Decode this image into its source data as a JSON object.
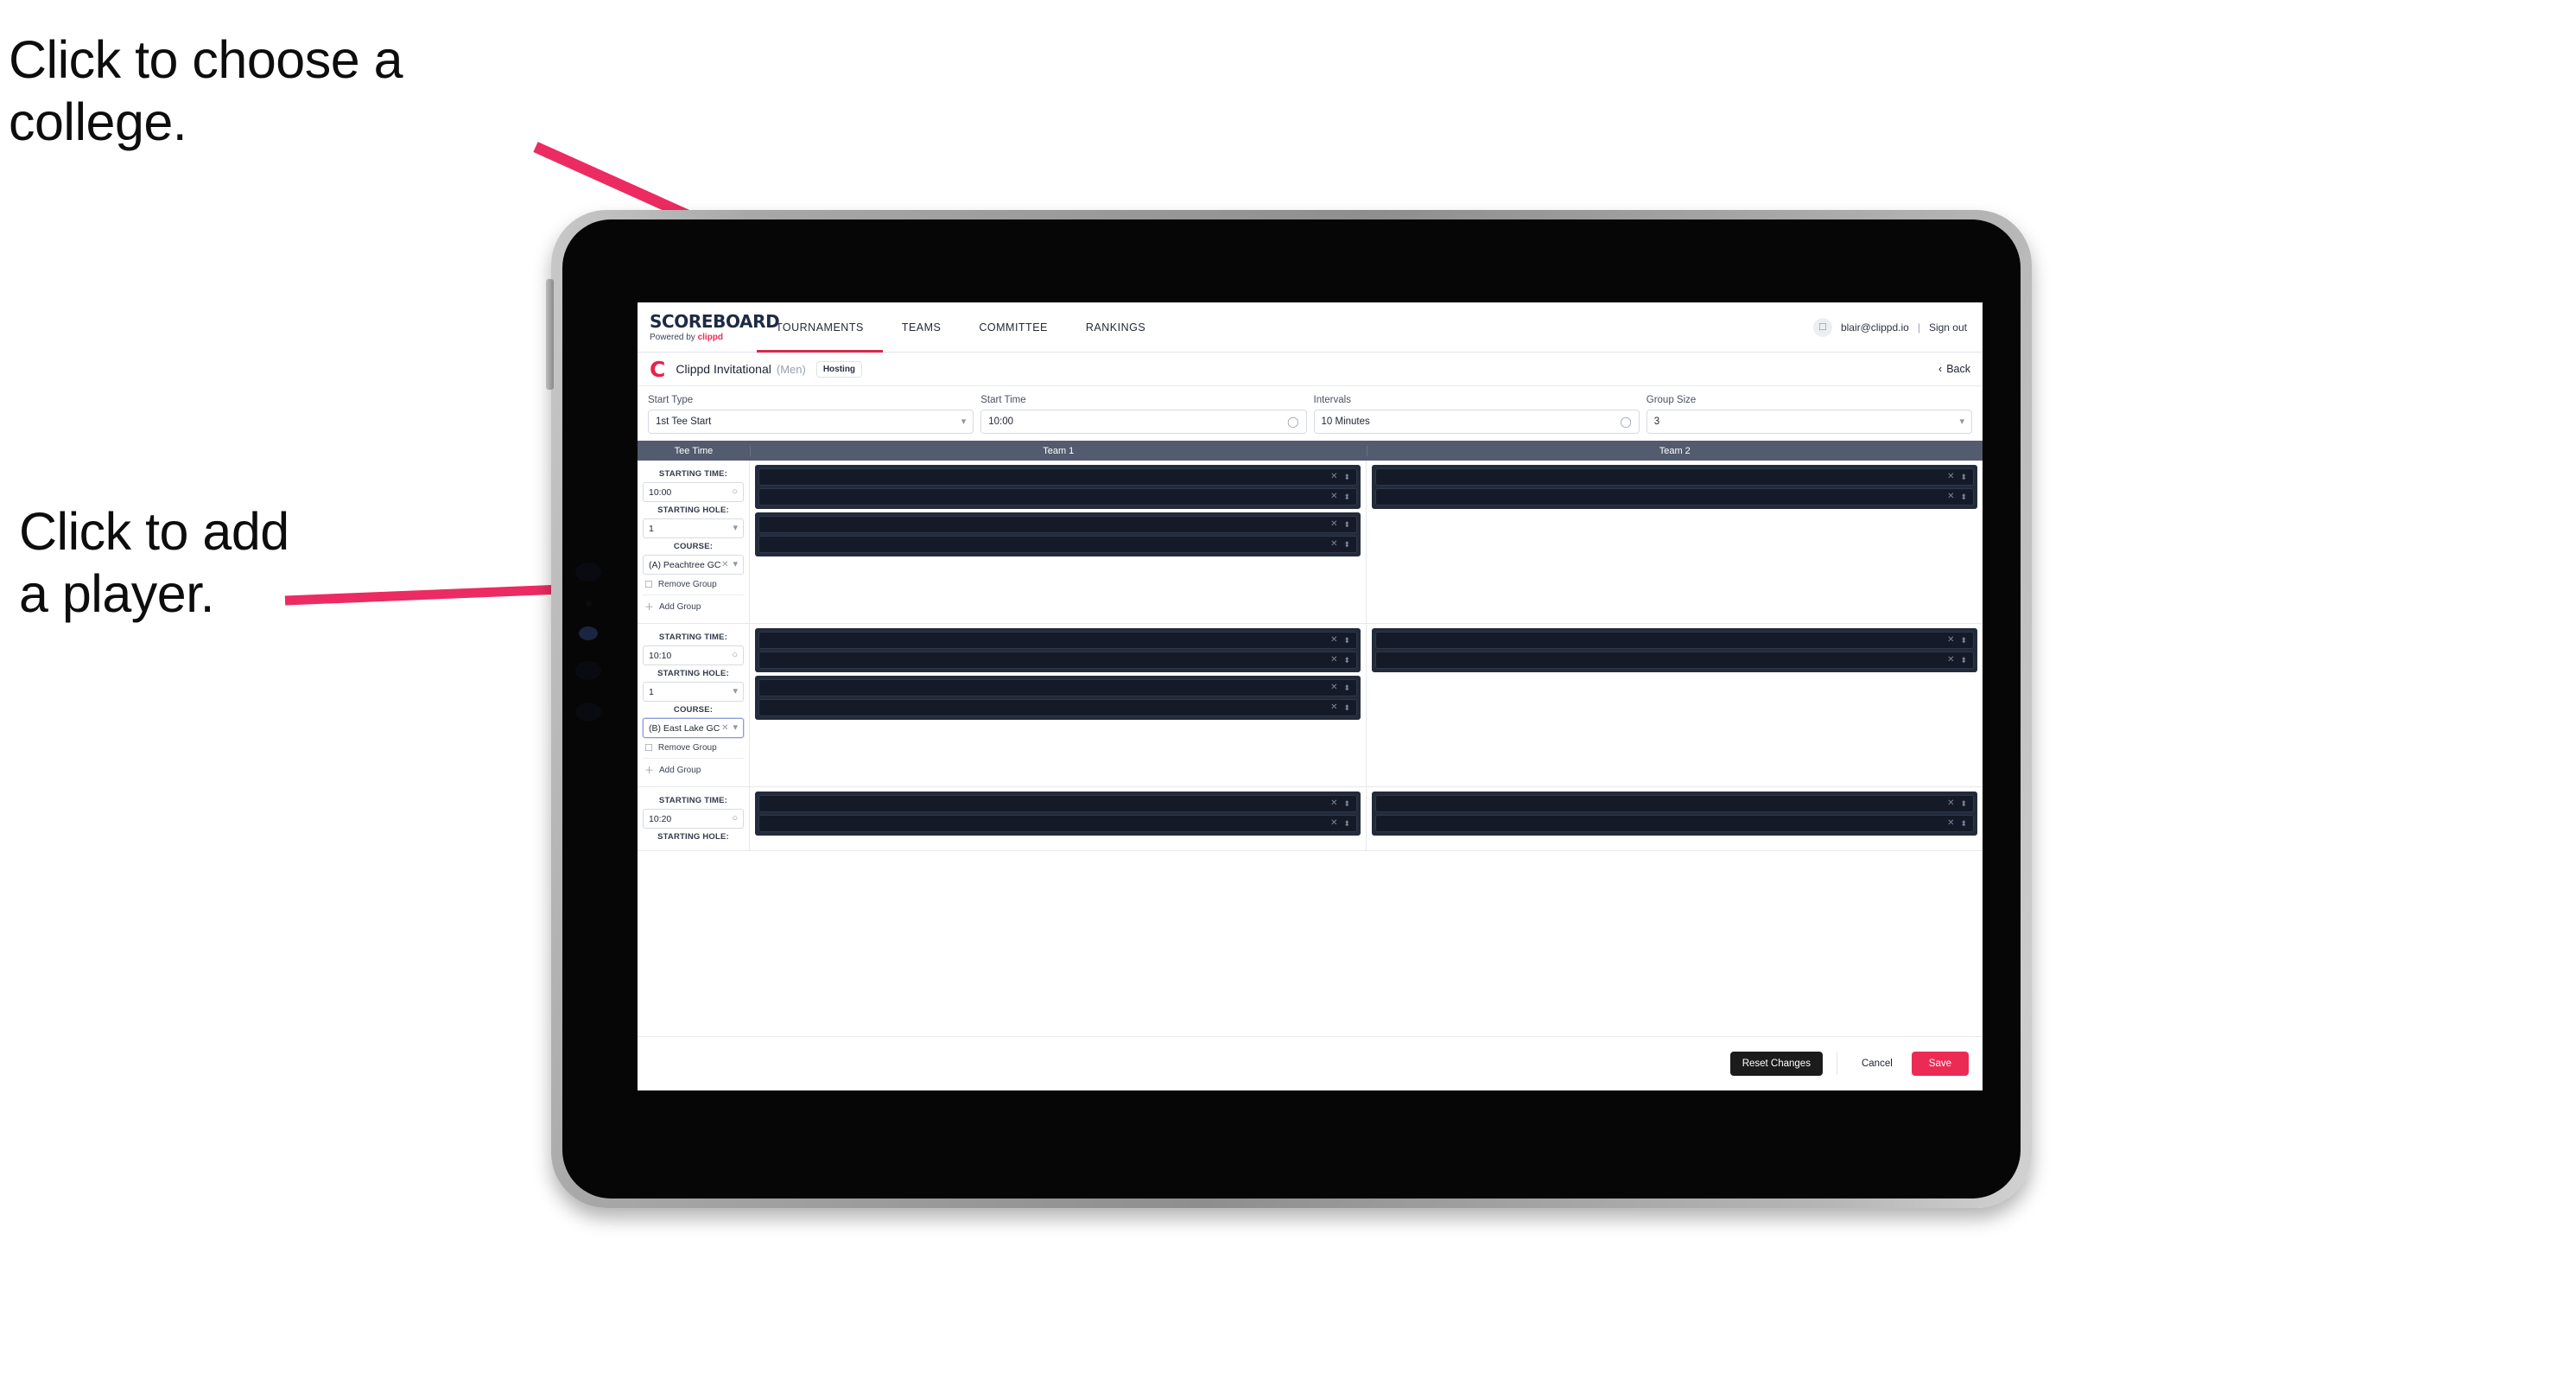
{
  "annotations": [
    {
      "id": "choose-college",
      "text": "Click to choose a\ncollege."
    },
    {
      "id": "add-player",
      "text": "Click to add\na player."
    }
  ],
  "app": {
    "nav": {
      "brand_title": "SCOREBOARD",
      "brand_sub_prefix": "Powered by ",
      "brand_sub_name": "clippd",
      "items": [
        {
          "label": "TOURNAMENTS",
          "active": true
        },
        {
          "label": "TEAMS",
          "active": false
        },
        {
          "label": "COMMITTEE",
          "active": false
        },
        {
          "label": "RANKINGS",
          "active": false
        }
      ],
      "avatar_icon": "user-icon",
      "user_email": "blair@clippd.io",
      "separator": "|",
      "sign_out": "Sign out"
    },
    "tournament_bar": {
      "logo_letter": "C",
      "name": "Clippd Invitational",
      "gender": "(Men)",
      "badge": "Hosting",
      "back_label": "Back",
      "back_icon": "chevron-left-icon"
    },
    "form": {
      "fields": [
        {
          "label": "Start Type",
          "value": "1st Tee Start",
          "icon": "stepper-icon"
        },
        {
          "label": "Start Time",
          "value": "10:00",
          "icon": "clock-icon"
        },
        {
          "label": "Intervals",
          "value": "10 Minutes",
          "icon": "clock-icon"
        },
        {
          "label": "Group Size",
          "value": "3",
          "icon": "stepper-icon"
        }
      ]
    },
    "table": {
      "headers": [
        "Tee Time",
        "Team 1",
        "Team 2"
      ],
      "labels": {
        "starting_time": "STARTING TIME:",
        "starting_hole": "STARTING HOLE:",
        "course": "COURSE:",
        "remove_group": "Remove Group",
        "add_group": "Add Group",
        "remove_icon": "trash-icon",
        "add_icon": "plus-icon",
        "clock_icon": "clock-icon",
        "stepper_icon": "stepper-icon",
        "clear_icon": "close-icon"
      },
      "rows": [
        {
          "starting_time": "10:00",
          "starting_hole": "1",
          "course": "(A) Peachtree GC",
          "course_focused": false,
          "team1_groups": [
            {
              "slots": [
                "",
                ""
              ]
            },
            {
              "slots": [
                "",
                ""
              ]
            }
          ],
          "team2_groups": [
            {
              "slots": [
                "",
                ""
              ]
            }
          ]
        },
        {
          "starting_time": "10:10",
          "starting_hole": "1",
          "course": "(B) East Lake GC",
          "course_focused": true,
          "team1_groups": [
            {
              "slots": [
                "",
                ""
              ]
            },
            {
              "slots": [
                "",
                ""
              ]
            }
          ],
          "team2_groups": [
            {
              "slots": [
                "",
                ""
              ]
            }
          ]
        },
        {
          "starting_time": "10:20",
          "starting_hole": "",
          "course": "",
          "course_focused": false,
          "team1_groups": [
            {
              "slots": [
                "",
                ""
              ]
            }
          ],
          "team2_groups": [
            {
              "slots": [
                "",
                ""
              ]
            }
          ]
        }
      ]
    },
    "footer": {
      "reset": "Reset Changes",
      "cancel": "Cancel",
      "save": "Save"
    }
  },
  "colors": {
    "accent_pink": "#ec2b55",
    "nav_underline": "#d32a4e",
    "table_header_bg": "#535b6e",
    "slot_bg": "#141a27",
    "group_bg": "#232b3a",
    "annotation_arrow": "#ec2b63"
  }
}
